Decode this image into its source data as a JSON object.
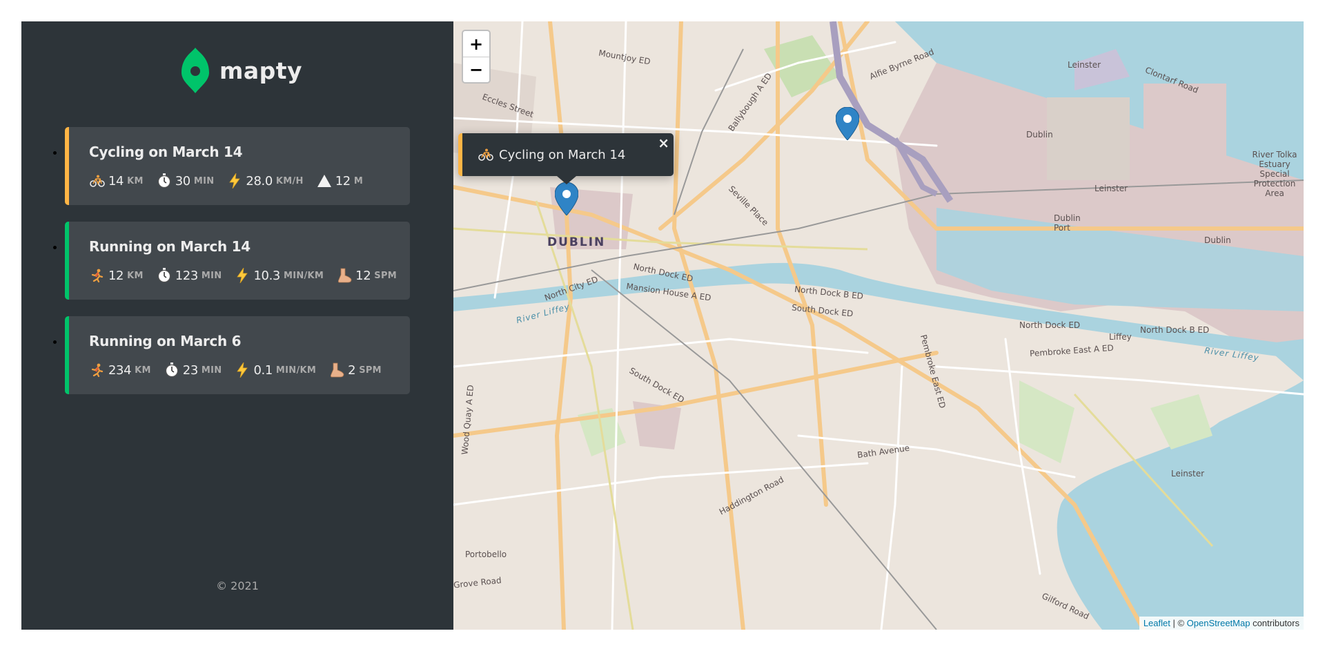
{
  "app": {
    "name": "mapty"
  },
  "workouts": [
    {
      "type": "cycling",
      "title": "Cycling on March 14",
      "details": [
        {
          "icon": "bicycle-icon",
          "value": "14",
          "unit": "KM"
        },
        {
          "icon": "stopwatch-icon",
          "value": "30",
          "unit": "MIN"
        },
        {
          "icon": "lightning-icon",
          "value": "28.0",
          "unit": "KM/H"
        },
        {
          "icon": "mountain-icon",
          "value": "12",
          "unit": "M"
        }
      ]
    },
    {
      "type": "running",
      "title": "Running on March 14",
      "details": [
        {
          "icon": "runner-icon",
          "value": "12",
          "unit": "KM"
        },
        {
          "icon": "stopwatch-icon",
          "value": "123",
          "unit": "MIN"
        },
        {
          "icon": "lightning-icon",
          "value": "10.3",
          "unit": "MIN/KM"
        },
        {
          "icon": "foot-icon",
          "value": "12",
          "unit": "SPM"
        }
      ]
    },
    {
      "type": "running",
      "title": "Running on March 6",
      "details": [
        {
          "icon": "runner-icon",
          "value": "234",
          "unit": "KM"
        },
        {
          "icon": "stopwatch-icon",
          "value": "23",
          "unit": "MIN"
        },
        {
          "icon": "lightning-icon",
          "value": "0.1",
          "unit": "MIN/KM"
        },
        {
          "icon": "foot-icon",
          "value": "2",
          "unit": "SPM"
        }
      ]
    }
  ],
  "footer": {
    "copyright": "© 2021"
  },
  "map": {
    "zoom_in": "+",
    "zoom_out": "−",
    "popup": {
      "text": "Cycling on March 14",
      "close": "×"
    },
    "attribution": {
      "leaflet": "Leaflet",
      "sep": " | © ",
      "osm": "OpenStreetMap",
      "suffix": " contributors"
    },
    "labels": {
      "dublin": "DUBLIN",
      "river_liffey_1": "River Liffey",
      "river_liffey_2": "River Liffey",
      "north_dock_1": "North Dock ED",
      "north_dock_2": "North Dock ED",
      "north_dock_b_1": "North Dock B ED",
      "north_dock_b_2": "North Dock B ED",
      "south_dock": "South Dock ED",
      "south_dock_2": "South Dock ED",
      "mansion_house": "Mansion House A ED",
      "north_city": "North City ED",
      "pembroke": "Pembroke East A ED",
      "pembroke_2": "Pembroke East ED",
      "bath_avenue": "Bath Avenue",
      "haddington": "Haddington Road",
      "portobello": "Portobello",
      "grove_road": "Grove Road",
      "leinster_1": "Leinster",
      "leinster_2": "Leinster",
      "leinster_3": "Leinster",
      "dublin_port": "Dublin Port",
      "dublin_a": "Dublin",
      "dublin_b": "Dublin",
      "alfie_byrne": "Alfie Byrne Road",
      "clontarf": "Clontarf Road",
      "mountjoy": "Mountjoy ED",
      "seville": "Seville Place",
      "liffey": "Liffey",
      "eccles": "Eccles Street",
      "wood_quay": "Wood Quay A ED",
      "gilford": "Gilford Road",
      "ballybough": "Ballybough A ED",
      "tolka": "River Tolka Estuary Special Protection Area"
    }
  }
}
